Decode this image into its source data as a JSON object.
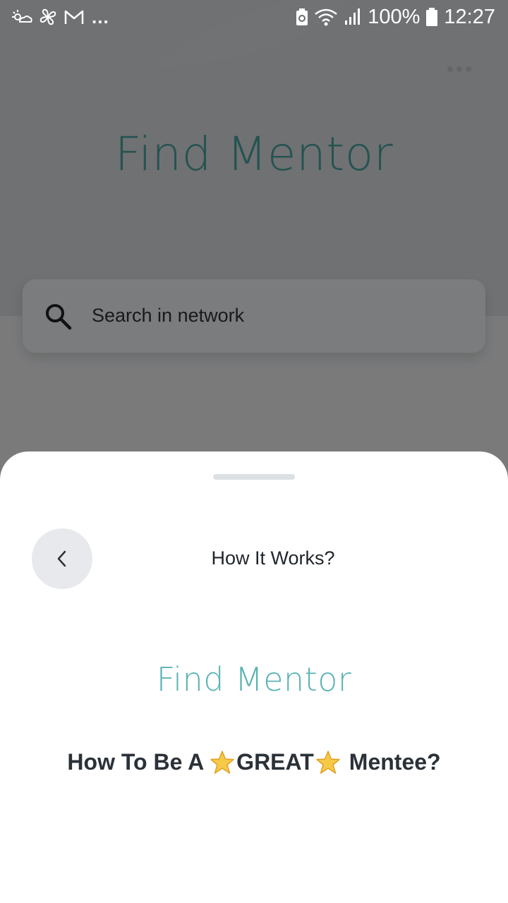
{
  "status_bar": {
    "battery": "100%",
    "time": "12:27",
    "more_notifications": "..."
  },
  "background": {
    "title": "Find Mentor",
    "search": {
      "placeholder": "Search in network"
    }
  },
  "sheet": {
    "title": "How It Works?",
    "brand": "Find Mentor",
    "subtitle": {
      "part1": "How To Be A",
      "emphasis": "GREAT",
      "part2": "Mentee?"
    }
  },
  "colors": {
    "brand_teal": "#5bb3b4",
    "scrim": "rgba(0,0,0,0.5)",
    "sheet_bg": "#ffffff",
    "back_button_bg": "#e8e9ec"
  },
  "icons": [
    "weather-icon",
    "pinwheel-icon",
    "gmail-icon",
    "battery-saver-icon",
    "wifi-icon",
    "signal-icon",
    "battery-icon",
    "search-icon",
    "more-icon",
    "chevron-left-icon",
    "star-icon"
  ]
}
